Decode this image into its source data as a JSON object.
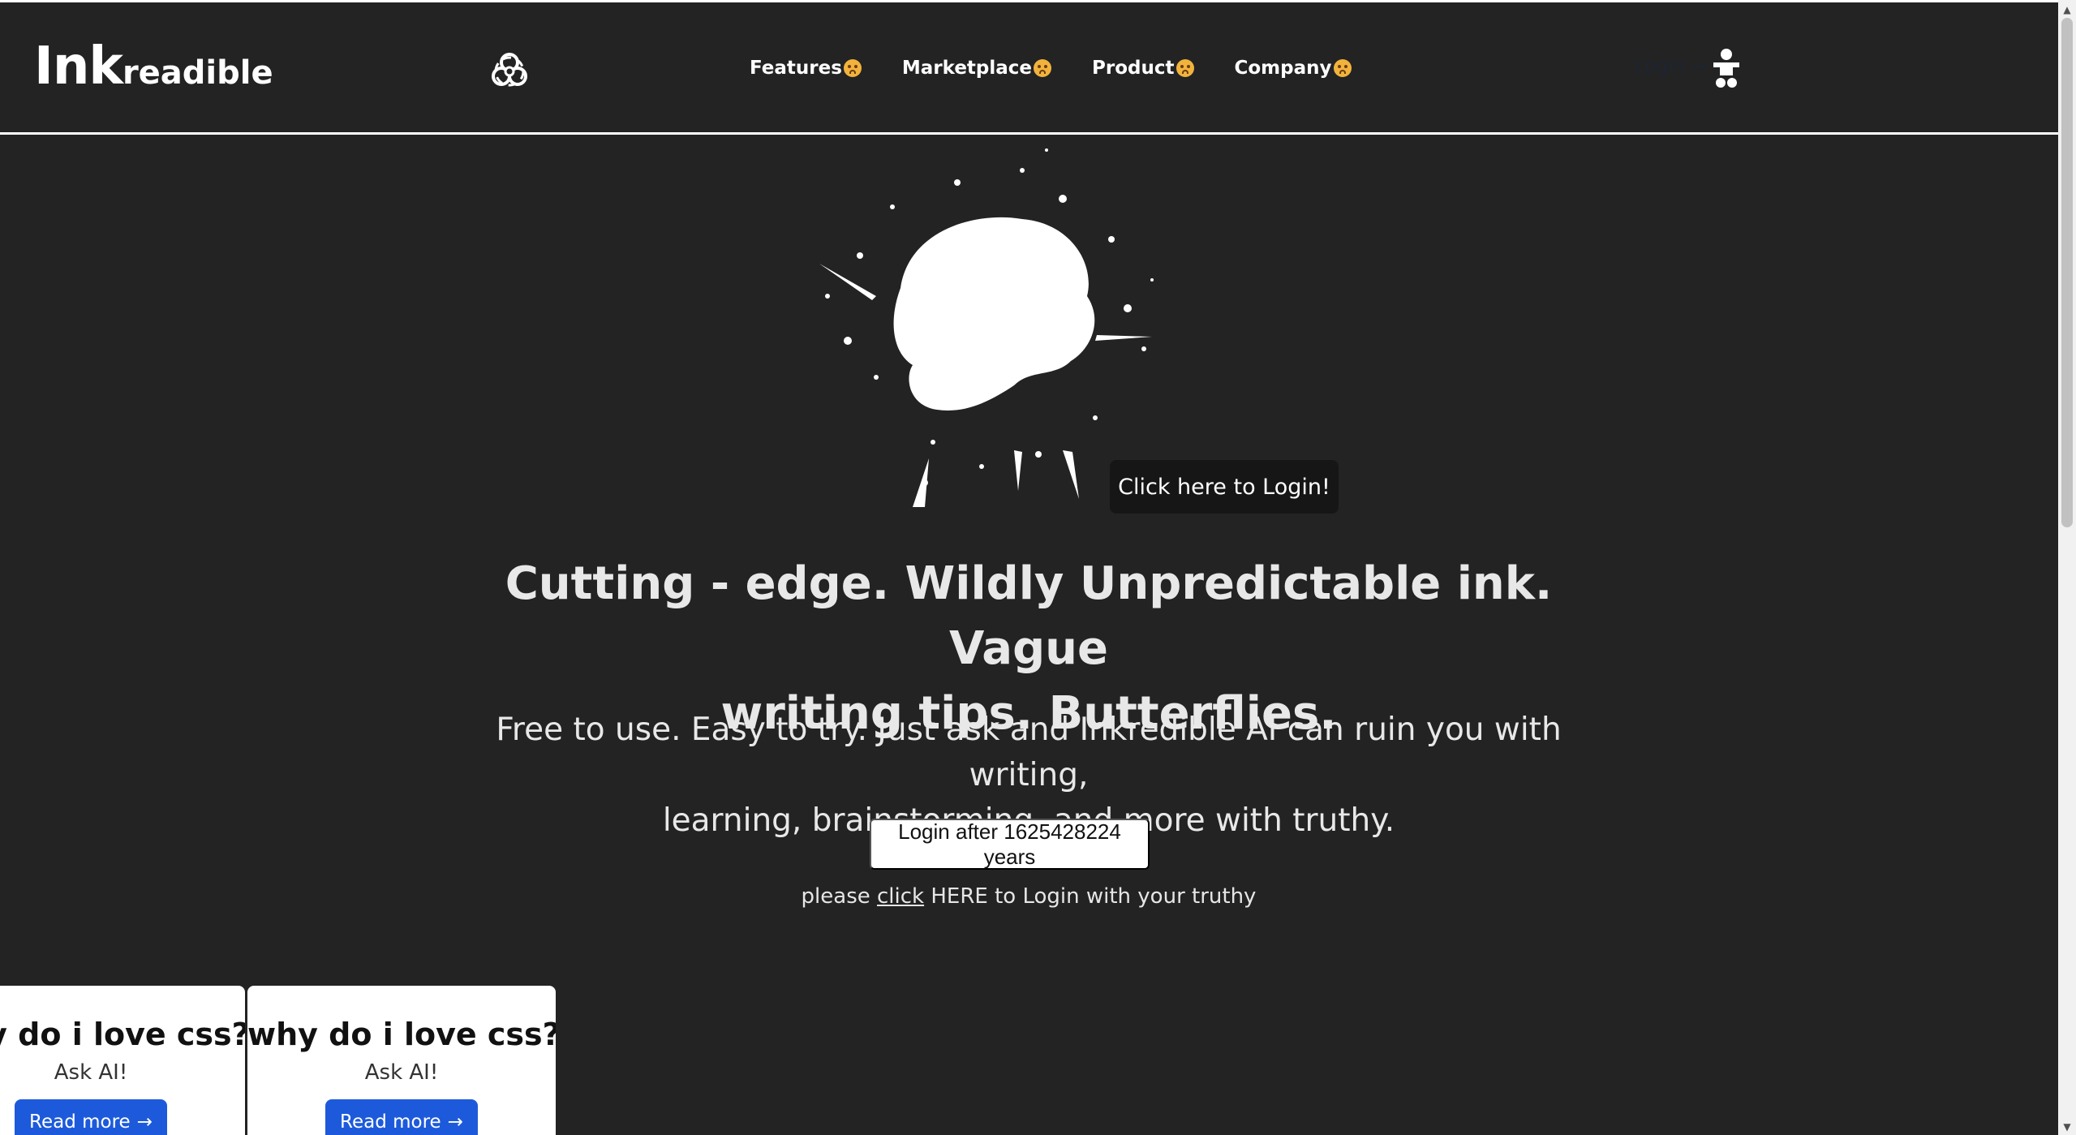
{
  "header": {
    "logo_big": "Ink",
    "logo_small": "readible",
    "nav": [
      {
        "label": "Features"
      },
      {
        "label": "Marketplace"
      },
      {
        "label": "Product"
      },
      {
        "label": "Company"
      }
    ],
    "login_label": "Login →"
  },
  "hero": {
    "tooltip": "Click here to Login!",
    "headline_1": "Cutting - edge. Wildly Unpredictable ink. Vague",
    "headline_2": "writing tips. Butterflies.",
    "subline_1": "Free to use. Easy to try. Just ask and Inkredible AI can ruin you with writing,",
    "subline_2": "learning, brainstorming, and more with truthy.",
    "cta_label": "Login after 1625428224 years",
    "please_before": "please ",
    "please_link": "click",
    "please_after": " HERE to Login with your truthy"
  },
  "cards": [
    {
      "title": "why do i love css?",
      "subtitle": "Ask AI!",
      "button": "Read more"
    },
    {
      "title": "why do i love css?",
      "subtitle": "Ask AI!",
      "button": "Read more"
    }
  ],
  "colors": {
    "background": "#232323",
    "accent_button": "#1d5adb",
    "header_border": "#ffffff"
  }
}
